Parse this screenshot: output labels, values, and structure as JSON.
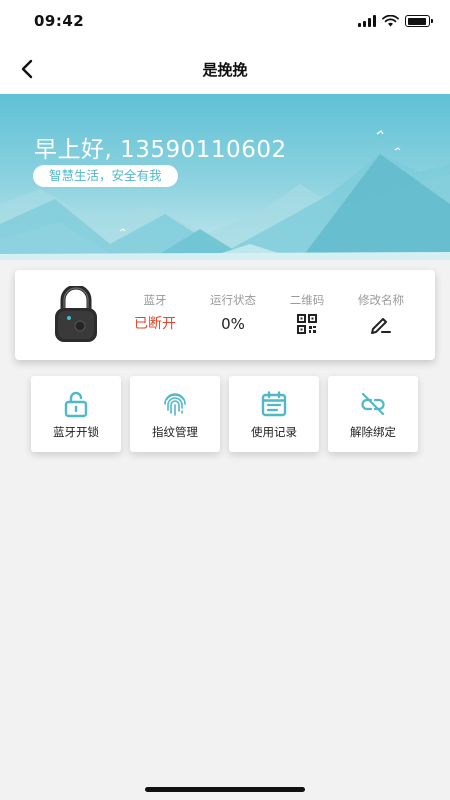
{
  "status_bar": {
    "time": "09:42",
    "battery_level": 0.9
  },
  "nav": {
    "title": "是挽挽",
    "back_icon": "chevron-left-icon"
  },
  "banner": {
    "greeting": "早上好, 13590110602",
    "slogan": "智慧生活，安全有我"
  },
  "device": {
    "image": "padlock-icon",
    "bluetooth_label": "蓝牙",
    "bluetooth_status": "已断开",
    "run_status_label": "运行状态",
    "run_status_value": "0%",
    "qrcode_label": "二维码",
    "qrcode_icon": "qrcode-icon",
    "rename_label": "修改名称",
    "rename_icon": "edit-pen-icon"
  },
  "actions": [
    {
      "label": "蓝牙开锁",
      "icon": "unlock-icon"
    },
    {
      "label": "指纹管理",
      "icon": "fingerprint-icon"
    },
    {
      "label": "使用记录",
      "icon": "calendar-icon"
    },
    {
      "label": "解除绑定",
      "icon": "unlink-icon"
    }
  ],
  "colors": {
    "accent": "#4fb8c9",
    "status_disconnected": "#e2462e",
    "background": "#f2f2f2"
  }
}
